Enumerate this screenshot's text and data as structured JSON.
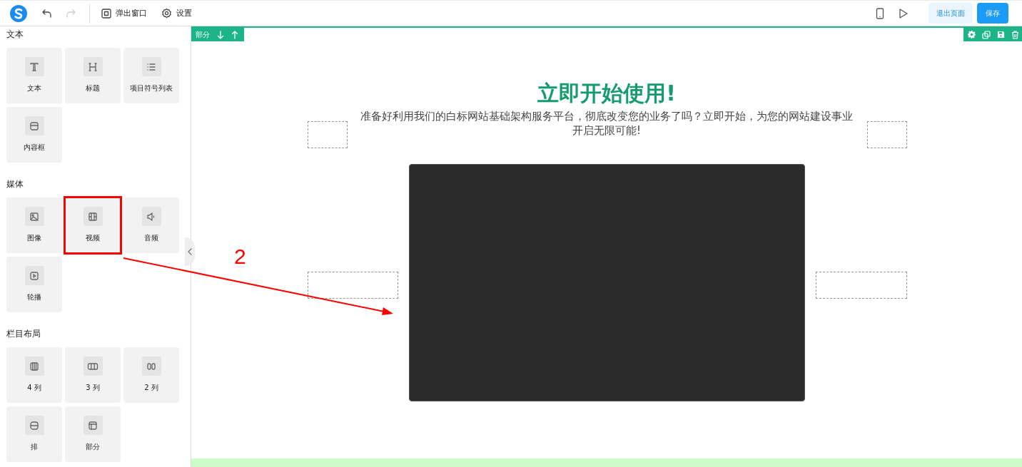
{
  "toolbar": {
    "items": [
      {
        "kind": "popup",
        "label": "弹出窗口"
      },
      {
        "kind": "settings",
        "label": "设置"
      }
    ],
    "exit_button": "退出页面",
    "save_button": "保存"
  },
  "sidebar": {
    "sections": [
      {
        "title": "文本",
        "items": [
          {
            "kind": "text",
            "label": "文本",
            "highlighted": false
          },
          {
            "kind": "heading",
            "label": "标题",
            "highlighted": false
          },
          {
            "kind": "list",
            "label": "项目符号列表",
            "highlighted": false
          },
          {
            "kind": "box",
            "label": "内容框",
            "highlighted": false
          }
        ]
      },
      {
        "title": "媒体",
        "items": [
          {
            "kind": "image",
            "label": "图像",
            "highlighted": false
          },
          {
            "kind": "video",
            "label": "视频",
            "highlighted": true
          },
          {
            "kind": "audio",
            "label": "音频",
            "highlighted": false
          },
          {
            "kind": "carousel",
            "label": "轮播",
            "highlighted": false
          }
        ]
      },
      {
        "title": "栏目布局",
        "items": [
          {
            "kind": "col4",
            "label": "4 列",
            "highlighted": false
          },
          {
            "kind": "col3",
            "label": "3 列",
            "highlighted": false
          },
          {
            "kind": "col2",
            "label": "2 列",
            "highlighted": false
          },
          {
            "kind": "row",
            "label": "排",
            "highlighted": false
          },
          {
            "kind": "section",
            "label": "部分",
            "highlighted": false
          }
        ]
      }
    ]
  },
  "canvas": {
    "section_label": "部分",
    "heading": "立即开始使用!",
    "description": "准备好利用我们的白标网站基础架构服务平台，彻底改变您的业务了吗？立即开始，为您的网站建设事业开启无限可能!"
  },
  "annotation": {
    "label": "2"
  }
}
